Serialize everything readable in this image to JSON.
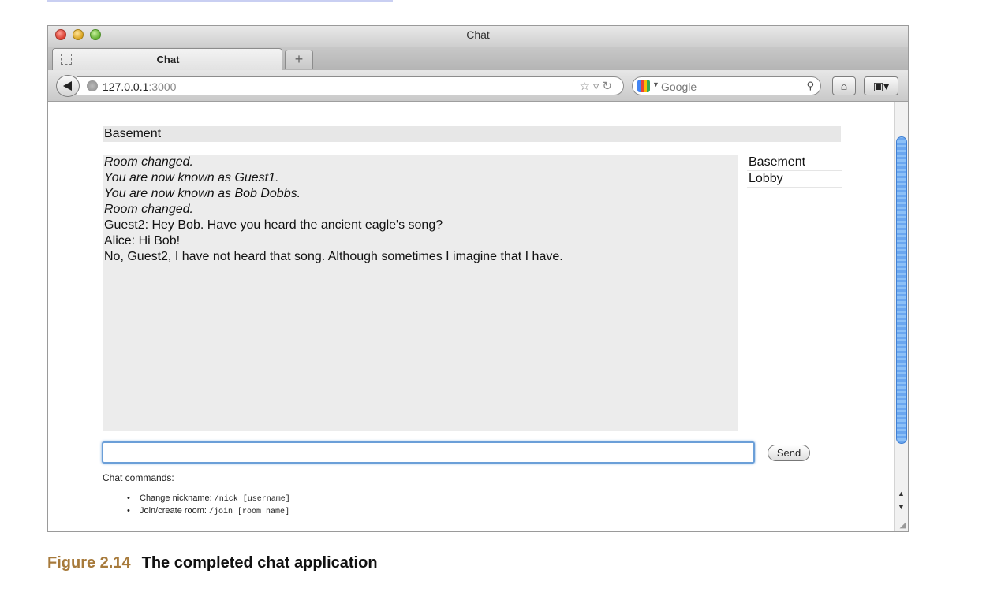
{
  "browser": {
    "window_title": "Chat",
    "tab_label": "Chat",
    "new_tab_symbol": "+",
    "url_host": "127.0.0.1",
    "url_port": ":3000",
    "search_placeholder": "Google"
  },
  "chat": {
    "room_header": "Basement",
    "messages": [
      {
        "text": "Room changed.",
        "type": "system"
      },
      {
        "text": "You are now known as Guest1.",
        "type": "system"
      },
      {
        "text": "You are now known as Bob Dobbs.",
        "type": "system"
      },
      {
        "text": "Room changed.",
        "type": "system"
      },
      {
        "text": "Guest2: Hey Bob. Have you heard the ancient eagle's song?",
        "type": "user"
      },
      {
        "text": "Alice: Hi Bob!",
        "type": "user"
      },
      {
        "text": "No, Guest2, I have not heard that song. Although sometimes I imagine that I have.",
        "type": "user"
      }
    ],
    "rooms": [
      "Basement",
      "Lobby"
    ],
    "input_value": "",
    "send_label": "Send"
  },
  "help": {
    "title": "Chat commands:",
    "commands": [
      {
        "label": "Change nickname: ",
        "code": "/nick [username]"
      },
      {
        "label": "Join/create room: ",
        "code": "/join [room name]"
      }
    ]
  },
  "caption": {
    "figure_number": "Figure 2.14",
    "text": "The completed chat application"
  },
  "colors": {
    "caption_accent": "#a77a3b",
    "message_area_bg": "#ececec",
    "input_focus": "#6b9fd8"
  }
}
